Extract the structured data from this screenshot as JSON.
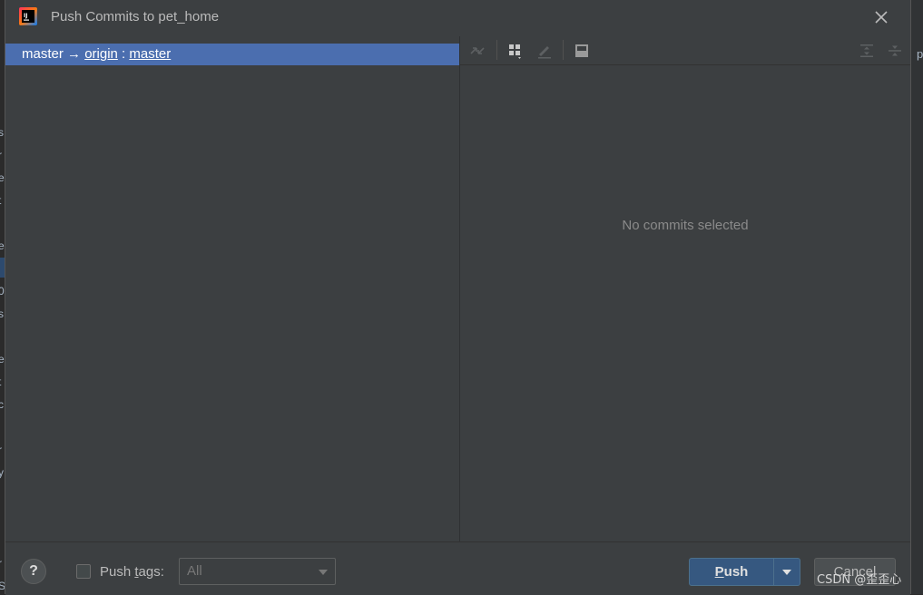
{
  "dialog": {
    "title": "Push Commits to pet_home"
  },
  "branch": {
    "local": "master",
    "arrow": "→",
    "remote": "origin",
    "sep": ":",
    "remote_branch": "master"
  },
  "details": {
    "empty_text": "No commits selected"
  },
  "toolbar": {
    "icons": [
      "merge-arrows-icon",
      "group-by-icon",
      "edit-icon",
      "preview-panel-icon",
      "expand-all-icon",
      "collapse-all-icon"
    ]
  },
  "footer": {
    "help": "?",
    "push_tags_label_pre": "Push ",
    "push_tags_label_mnemonic": "t",
    "push_tags_label_post": "ags:",
    "tags_select_value": "All",
    "push_mnemonic": "P",
    "push_rest": "ush",
    "cancel_label": "Cancel"
  },
  "background": {
    "left_edge_chars": [
      "s",
      "r",
      "e",
      "t",
      "e",
      "0",
      "s",
      "e",
      "t",
      "c",
      "r",
      "y",
      "r",
      "S"
    ],
    "right_edge_char": "p"
  },
  "watermark": "CSDN @歪歪心",
  "colors": {
    "selection": "#4b6eaf",
    "dialog_bg": "#3c3f41",
    "push_button": "#365880"
  }
}
